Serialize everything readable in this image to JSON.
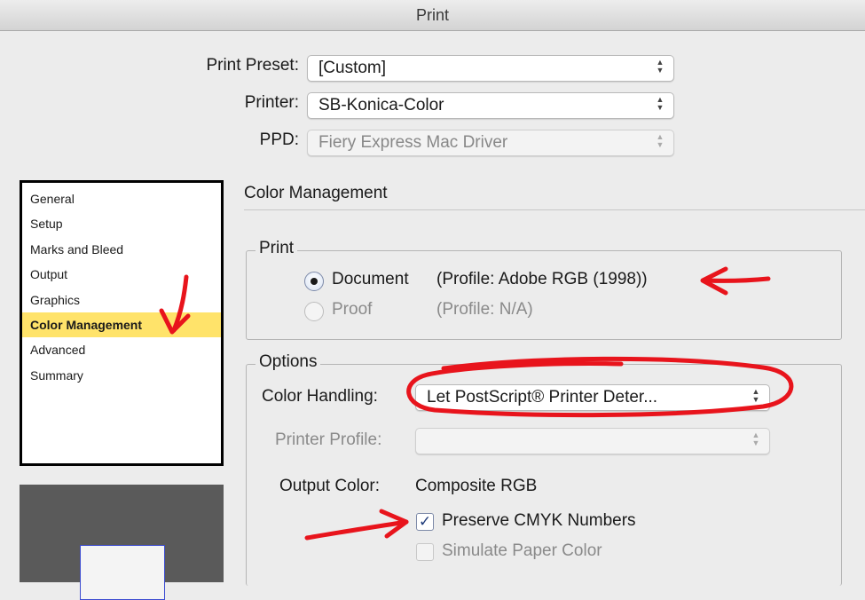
{
  "window": {
    "title": "Print"
  },
  "header": {
    "print_preset": {
      "label": "Print Preset:",
      "value": "[Custom]"
    },
    "printer": {
      "label": "Printer:",
      "value": "SB-Konica-Color"
    },
    "ppd": {
      "label": "PPD:",
      "value": "Fiery Express Mac Driver"
    }
  },
  "sidebar": {
    "items": [
      {
        "label": "General"
      },
      {
        "label": "Setup"
      },
      {
        "label": "Marks and Bleed"
      },
      {
        "label": "Output"
      },
      {
        "label": "Graphics"
      },
      {
        "label": "Color Management",
        "selected": true
      },
      {
        "label": "Advanced"
      },
      {
        "label": "Summary"
      }
    ]
  },
  "main": {
    "section_title": "Color Management",
    "print_group": {
      "legend": "Print",
      "document": {
        "label": "Document",
        "profile": "(Profile: Adobe RGB (1998))",
        "selected": true
      },
      "proof": {
        "label": "Proof",
        "profile": "(Profile: N/A)",
        "selected": false
      }
    },
    "options_group": {
      "legend": "Options",
      "color_handling": {
        "label": "Color Handling:",
        "value": "Let PostScript® Printer Deter..."
      },
      "printer_profile": {
        "label": "Printer Profile:",
        "value": ""
      },
      "output_color": {
        "label": "Output Color:",
        "value": "Composite RGB"
      },
      "preserve_cmyk": {
        "label": "Preserve CMYK Numbers",
        "checked": true
      },
      "simulate_paper": {
        "label": "Simulate Paper Color",
        "checked": false
      }
    }
  },
  "colors": {
    "selection_highlight": "#ffe36a",
    "annotation_red": "#e8141c"
  },
  "icons": {
    "select_arrows": "updown-chevron-icon",
    "checkmark": "checkmark-icon"
  }
}
